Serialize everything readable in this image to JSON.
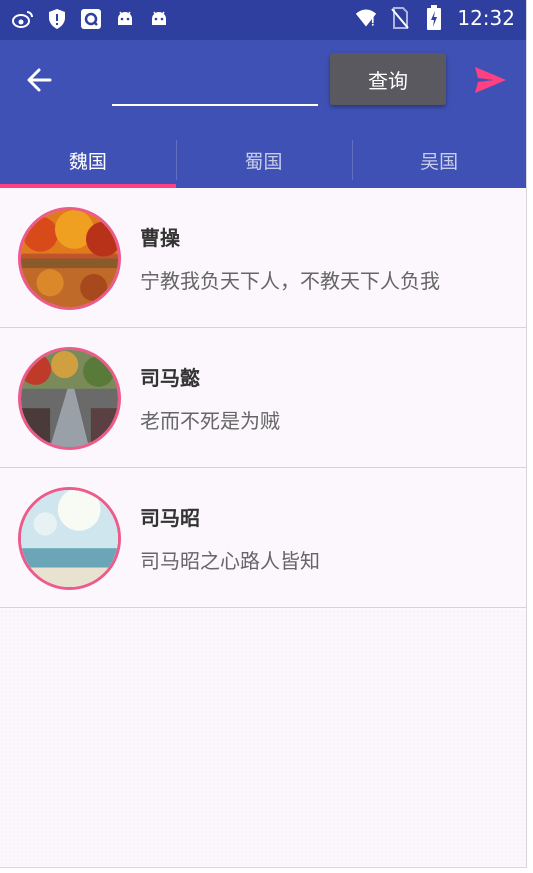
{
  "status_bar": {
    "time": "12:32",
    "icons": [
      "weibo-icon",
      "shield-icon",
      "sync-icon",
      "android-icon",
      "android-icon",
      "wifi-icon",
      "no-sim-icon",
      "battery-icon"
    ]
  },
  "app_bar": {
    "back_icon": "arrow-left-icon",
    "search_value": "",
    "query_button_label": "查询",
    "send_icon": "send-icon",
    "accent_color": "#ff4081",
    "primary_color": "#3f51b5"
  },
  "tabs": [
    {
      "label": "魏国",
      "active": true
    },
    {
      "label": "蜀国",
      "active": false
    },
    {
      "label": "吴国",
      "active": false
    }
  ],
  "list": [
    {
      "name": "曹操",
      "quote": "宁教我负天下人，不教天下人负我",
      "avatar": "autumn-forest-photo"
    },
    {
      "name": "司马懿",
      "quote": "老而不死是为贼",
      "avatar": "rainy-avenue-photo"
    },
    {
      "name": "司马昭",
      "quote": "司马昭之心路人皆知",
      "avatar": "seaside-sky-photo"
    }
  ]
}
